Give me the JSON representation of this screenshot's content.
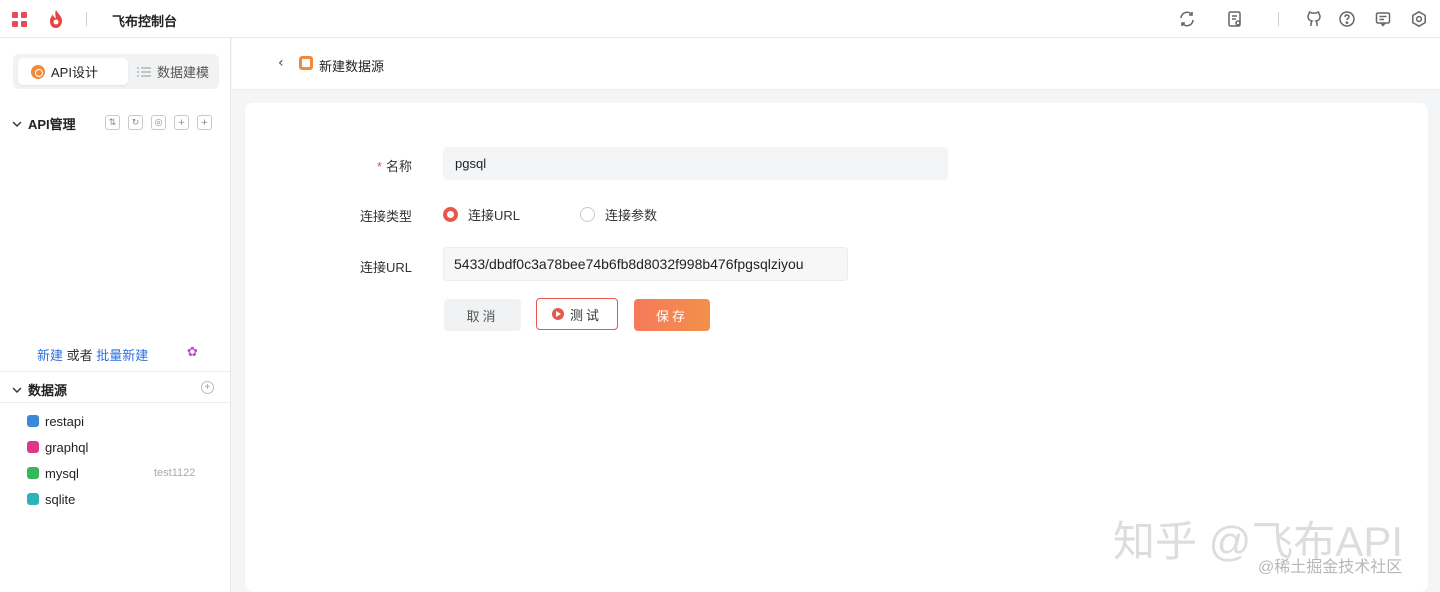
{
  "app": {
    "title": "飞布控制台"
  },
  "sidebar": {
    "tabs": [
      {
        "label": "API设计",
        "icon": "api-design-icon",
        "active": true
      },
      {
        "label": "数据建模",
        "icon": "list-icon",
        "active": false
      }
    ],
    "api_section": {
      "label": "API管理"
    },
    "new_row": {
      "new_link": "新建",
      "or": " 或者 ",
      "batch_link": "批量新建"
    },
    "datasource_section": {
      "label": "数据源"
    },
    "datasources": [
      {
        "name": "restapi",
        "color": "#3b8ad9"
      },
      {
        "name": "graphql",
        "color": "#e0368a"
      },
      {
        "name": "mysql",
        "color": "#35b85a",
        "meta": "test1122"
      },
      {
        "name": "sqlite",
        "color": "#2bb3b8"
      }
    ]
  },
  "page": {
    "title": "新建数据源",
    "form": {
      "name_label": "名称",
      "name_value": "pgsql",
      "conn_type_label": "连接类型",
      "conn_type_options": [
        "连接URL",
        "连接参数"
      ],
      "conn_type_selected": "连接URL",
      "conn_url_label": "连接URL",
      "conn_url_value": "5433/dbdf0c3a78bee74b6fb8d8032f998b476fpgsqlziyou"
    },
    "buttons": {
      "cancel": "取消",
      "test": "测试",
      "save": "保存"
    }
  },
  "watermark": {
    "main": "知乎 @飞布API",
    "sub": "@稀土掘金技术社区"
  },
  "colors": {
    "accent": "#e8574b",
    "brand_red": "#e34d59",
    "link": "#2f6fe0"
  }
}
